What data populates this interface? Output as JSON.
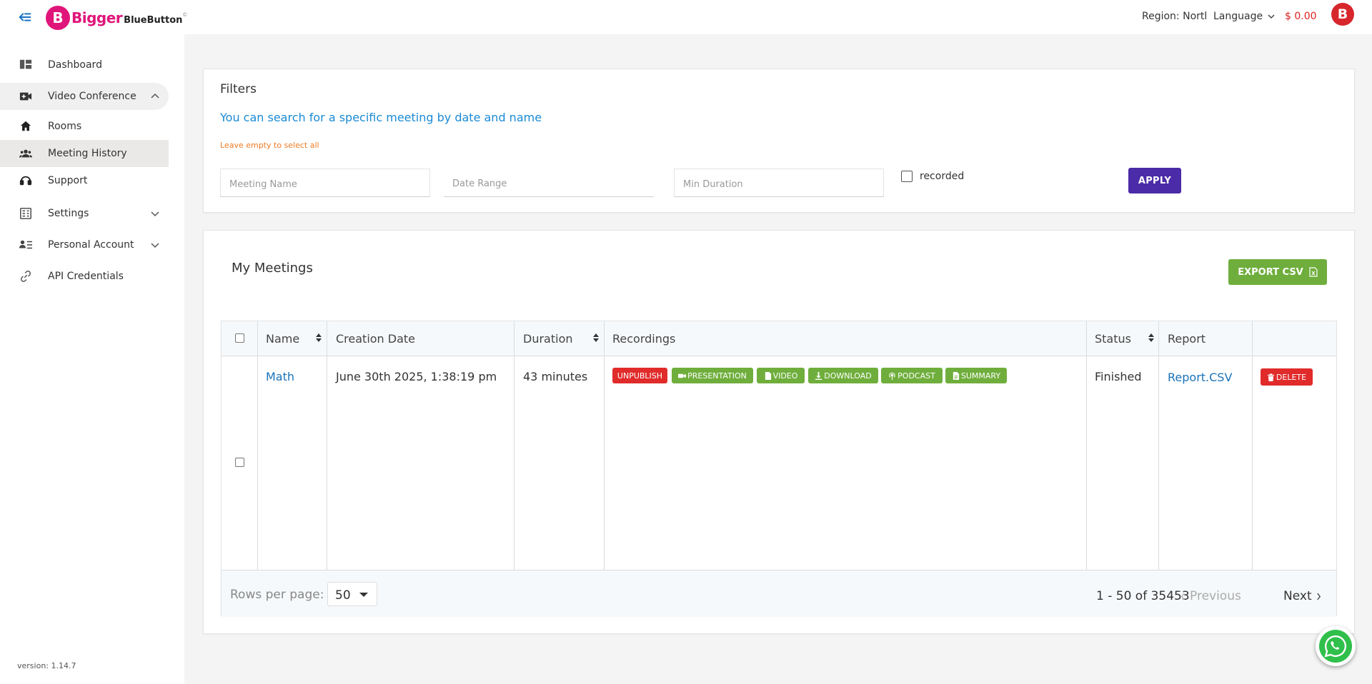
{
  "header": {
    "logo_text_1": "Bigger",
    "logo_text_2": "BlueButton",
    "logo_mark": "©",
    "region": "Region: North",
    "language": "Language",
    "balance": "$ 0.00",
    "avatar_letter": "B"
  },
  "sidebar": {
    "items": [
      {
        "label": "Dashboard",
        "icon": "dashboard-icon"
      },
      {
        "label": "Video Conference",
        "icon": "video-camera-icon"
      },
      {
        "label": "Rooms",
        "icon": "home-icon"
      },
      {
        "label": "Meeting History",
        "icon": "people-icon"
      },
      {
        "label": "Support",
        "icon": "headset-icon"
      },
      {
        "label": "Settings",
        "icon": "settings-icon"
      },
      {
        "label": "Personal Account",
        "icon": "account-list-icon"
      },
      {
        "label": "API Credentials",
        "icon": "link-icon"
      }
    ],
    "version": "version: 1.14.7"
  },
  "filters": {
    "title": "Filters",
    "subtitle": "You can search for a specific meeting by date and name",
    "hint": "Leave empty to select all",
    "meeting_name_placeholder": "Meeting Name",
    "date_range_placeholder": "Date Range",
    "min_duration_placeholder": "Min Duration",
    "recorded_label": "recorded",
    "apply_label": "APPLY"
  },
  "meetings": {
    "title": "My Meetings",
    "export_label": "EXPORT CSV",
    "columns": [
      "Name",
      "Creation Date",
      "Duration",
      "Recordings",
      "Status",
      "Report"
    ],
    "rows": [
      {
        "name": "Math",
        "creation_date": "June 30th 2025, 1:38:19 pm",
        "duration": "43 minutes",
        "recordings": {
          "unpublish": "UNPUBLISH",
          "presentation": "PRESENTATION",
          "video": "VIDEO",
          "download": "DOWNLOAD",
          "podcast": "PODCAST",
          "summary": "SUMMARY"
        },
        "status": "Finished",
        "report": "Report.CSV",
        "delete": "DELETE"
      }
    ],
    "footer": {
      "rows_per_page_label": "Rows per page:",
      "rows_per_page_value": "50",
      "range": "1 - 50 of 35453",
      "previous": "Previous",
      "next": "Next"
    }
  },
  "colors": {
    "brand": "#e0157a",
    "link": "#1a8ad4",
    "apply": "#4b2ba7",
    "green": "#6fae3c",
    "red": "#e12b2b"
  }
}
